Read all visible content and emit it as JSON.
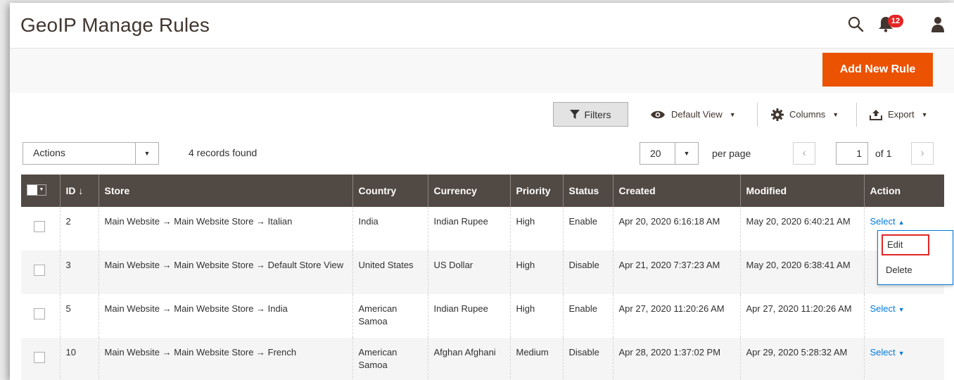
{
  "header": {
    "title": "GeoIP Manage Rules",
    "notification_count": "12"
  },
  "page_actions": {
    "add_new_rule": "Add New Rule"
  },
  "toolbar": {
    "filters": "Filters",
    "default_view": "Default View",
    "columns": "Columns",
    "export": "Export"
  },
  "controls": {
    "actions": "Actions",
    "records_found": "4 records found",
    "per_page_value": "20",
    "per_page_label": "per page",
    "current_page": "1",
    "of_pages": "of 1"
  },
  "table": {
    "columns": [
      "ID",
      "Store",
      "Country",
      "Currency",
      "Priority",
      "Status",
      "Created",
      "Modified",
      "Action"
    ],
    "id_sort_indicator": "↓",
    "rows": [
      {
        "id": "2",
        "store": "Main Website → Main Website Store → Italian",
        "country": "India",
        "currency": "Indian Rupee",
        "priority": "High",
        "status": "Enable",
        "created": "Apr 20, 2020 6:16:18 AM",
        "modified": "May 20, 2020 6:40:21 AM",
        "action": "Select"
      },
      {
        "id": "3",
        "store": "Main Website → Main Website Store → Default Store View",
        "country": "United States",
        "currency": "US Dollar",
        "priority": "High",
        "status": "Disable",
        "created": "Apr 21, 2020 7:37:23 AM",
        "modified": "May 20, 2020 6:38:41 AM",
        "action": ""
      },
      {
        "id": "5",
        "store": "Main Website → Main Website Store → India",
        "country": "American Samoa",
        "currency": "Indian Rupee",
        "priority": "High",
        "status": "Enable",
        "created": "Apr 27, 2020 11:20:26 AM",
        "modified": "Apr 27, 2020 11:20:26 AM",
        "action": "Select"
      },
      {
        "id": "10",
        "store": "Main Website → Main Website Store → French",
        "country": "American Samoa",
        "currency": "Afghan Afghani",
        "priority": "Medium",
        "status": "Disable",
        "created": "Apr 28, 2020 1:37:02 PM",
        "modified": "Apr 29, 2020 5:28:32 AM",
        "action": "Select"
      }
    ]
  },
  "action_dropdown": {
    "edit": "Edit",
    "delete": "Delete"
  },
  "colors": {
    "accent": "#eb5202",
    "header_bg": "#514943",
    "link": "#007bdb",
    "highlight": "#e22626"
  }
}
